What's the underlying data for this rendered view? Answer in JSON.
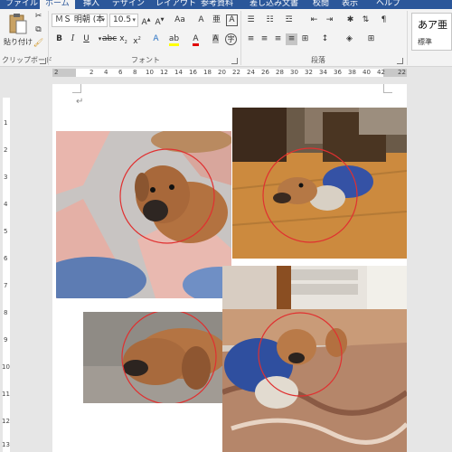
{
  "tabs": [
    {
      "label": "ファイル",
      "active": false
    },
    {
      "label": "ホーム",
      "active": true
    },
    {
      "label": "挿入",
      "active": false
    },
    {
      "label": "デザイン",
      "active": false
    },
    {
      "label": "レイアウト",
      "active": false
    },
    {
      "label": "参考資料",
      "active": false
    },
    {
      "label": "差し込み文書",
      "active": false
    },
    {
      "label": "校閲",
      "active": false
    },
    {
      "label": "表示",
      "active": false
    },
    {
      "label": "ヘルプ",
      "active": false
    }
  ],
  "clipboard": {
    "paste_label": "貼り付け",
    "group_label": "クリップボード"
  },
  "font": {
    "name": "ＭＳ 明朝 (本",
    "size": "10.5",
    "group_label": "フォント"
  },
  "paragraph": {
    "group_label": "段落"
  },
  "styles": {
    "sample": "あア亜",
    "name": "標準"
  },
  "ruler": {
    "top_numbers": [
      "2",
      "2",
      "4",
      "6",
      "8",
      "10",
      "12",
      "14",
      "16",
      "18",
      "20",
      "22",
      "24",
      "26",
      "28",
      "30",
      "32",
      "34",
      "36",
      "38",
      "40",
      "42",
      "22"
    ],
    "left_numbers": [
      "1",
      "2",
      "3",
      "4",
      "5",
      "6",
      "7",
      "8",
      "9",
      "10",
      "11",
      "12",
      "13"
    ]
  },
  "document": {
    "paragraph_mark": "↵"
  },
  "colors": {
    "accent": "#2b579a",
    "circle": "#e03030",
    "font_color": "#e00000",
    "highlight": "#ffff00"
  }
}
